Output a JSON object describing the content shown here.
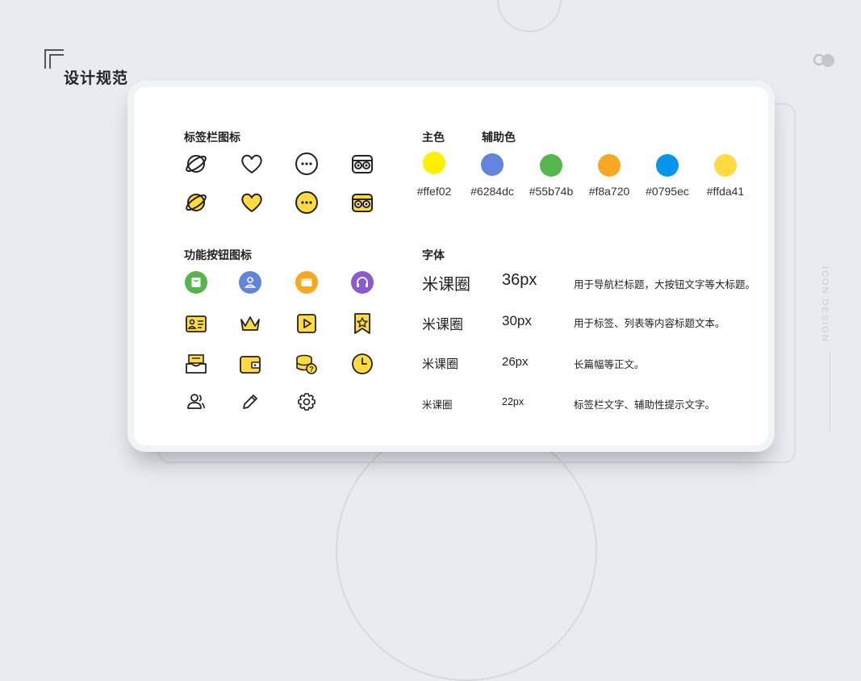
{
  "page": {
    "title": "设计规范",
    "side_text": "ICON DESIGN"
  },
  "tab_icons": {
    "title": "标签栏图标",
    "outline": [
      "planet-outline-icon",
      "heart-outline-icon",
      "chat-dots-outline-icon",
      "owl-outline-icon"
    ],
    "filled": [
      "planet-filled-icon",
      "heart-filled-icon",
      "chat-dots-filled-icon",
      "owl-filled-icon"
    ]
  },
  "function_icons": {
    "title": "功能按钮图标",
    "row1": [
      {
        "name": "shopping-bag-icon",
        "color": "#55b74b"
      },
      {
        "name": "user-icon",
        "color": "#6284dc"
      },
      {
        "name": "message-icon",
        "color": "#f8a720"
      },
      {
        "name": "headphones-icon",
        "color": "#8a5bd0"
      }
    ],
    "row2": [
      "id-card-icon",
      "crown-icon",
      "play-icon",
      "bookmark-star-icon"
    ],
    "row3": [
      "inbox-icon",
      "wallet-icon",
      "coins-question-icon",
      "clock-icon"
    ],
    "row4": [
      "people-icon",
      "pencil-icon",
      "gear-icon"
    ]
  },
  "colors": {
    "primary_label": "主色",
    "secondary_label": "辅助色",
    "swatches": [
      {
        "hex": "#ffef02",
        "label": "#ffef02"
      },
      {
        "hex": "#6284dc",
        "label": "#6284dc"
      },
      {
        "hex": "#55b74b",
        "label": "#55b74b"
      },
      {
        "hex": "#f8a720",
        "label": "#f8a720"
      },
      {
        "hex": "#0795ec",
        "label": "#0795ec"
      },
      {
        "hex": "#ffda41",
        "label": "#ffda41"
      }
    ]
  },
  "fonts": {
    "title": "字体",
    "rows": [
      {
        "sample": "米课圈",
        "size": "36px",
        "desc": "用于导航栏标题，大按钮文字等大标题。"
      },
      {
        "sample": "米课圈",
        "size": "30px",
        "desc": "用于标签、列表等内容标题文本。"
      },
      {
        "sample": "米课圈",
        "size": "26px",
        "desc": "长篇幅等正文。"
      },
      {
        "sample": "米课圈",
        "size": "22px",
        "desc": "标签栏文字、辅助性提示文字。"
      }
    ]
  }
}
